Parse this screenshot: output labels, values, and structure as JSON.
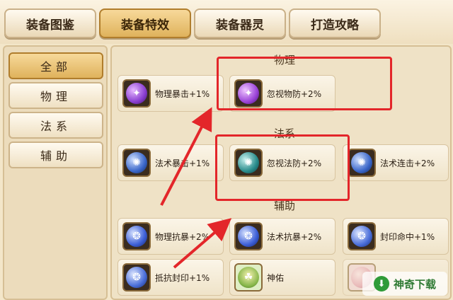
{
  "tabs": [
    {
      "label": "装备图鉴",
      "active": false
    },
    {
      "label": "装备特效",
      "active": true
    },
    {
      "label": "装备器灵",
      "active": false
    },
    {
      "label": "打造攻略",
      "active": false
    }
  ],
  "sidebar": {
    "items": [
      {
        "label": "全部",
        "active": true
      },
      {
        "label": "物理",
        "active": false
      },
      {
        "label": "法系",
        "active": false
      },
      {
        "label": "辅助",
        "active": false
      }
    ]
  },
  "sections": {
    "physical": "物理",
    "magic": "法系",
    "support": "辅助"
  },
  "effects": {
    "phys_crit": {
      "label": "物理暴击+1%",
      "icon": "purple-orb-icon",
      "color": "#8a3fd1"
    },
    "ignore_phys_def": {
      "label": "忽视物防+2%",
      "icon": "purple-orb-icon",
      "color": "#9b44d8"
    },
    "magic_crit": {
      "label": "法术暴击+1%",
      "icon": "blue-orb-icon",
      "color": "#3b67c9"
    },
    "ignore_magic_def": {
      "label": "忽视法防+2%",
      "icon": "teal-orb-icon",
      "color": "#2a8c8c"
    },
    "magic_combo": {
      "label": "法术连击+2%",
      "icon": "blue-orb-icon",
      "color": "#3b67c9"
    },
    "phys_crit_resist": {
      "label": "物理抗暴+2%",
      "icon": "blue-orb-icon",
      "color": "#3d5fd6"
    },
    "magic_crit_resist": {
      "label": "法术抗暴+2%",
      "icon": "blue-orb-icon",
      "color": "#3d5fd6"
    },
    "seal_hit": {
      "label": "封印命中+1%",
      "icon": "blue-orb-icon",
      "color": "#4a6ed9"
    },
    "seal_resist": {
      "label": "抵抗封印+1%",
      "icon": "blue-orb-icon",
      "color": "#4a6ed9"
    },
    "blessing": {
      "label": "神佑",
      "icon": "green-figure-icon",
      "color": "#86b64a"
    }
  },
  "watermark": {
    "text": "神奇下载"
  },
  "colors": {
    "highlight": "#e3262a",
    "active_tab": "#dfb25c"
  }
}
